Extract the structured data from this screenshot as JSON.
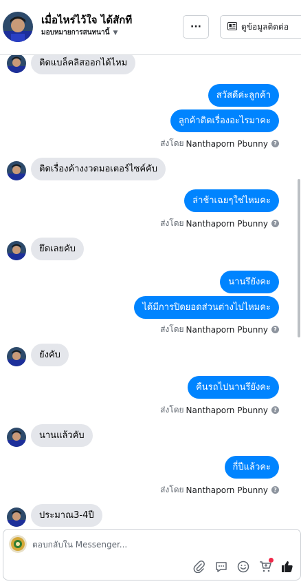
{
  "header": {
    "contact_name": "เมื่อไหร่ไว้ใจ ได้สักที",
    "assign_label": "มอบหมายการสนทนานี้",
    "more_label": "···",
    "contact_info_label": "ดูข้อมูลติดต่อ"
  },
  "messages": [
    {
      "side": "in",
      "text": "ติดแบล็คลิสออกได้ไหม"
    },
    {
      "side": "out",
      "text": "สวัสดีค่ะลูกค้า"
    },
    {
      "side": "out",
      "text": "ลูกค้าติดเรื่องอะไรมาคะ"
    },
    {
      "side": "sent_by",
      "prefix": "ส่งโดย",
      "name": "Nanthaporn Pbunny"
    },
    {
      "side": "in",
      "text": "ติดเรื่องค้างงวดมอเตอร์ไซค์คับ"
    },
    {
      "side": "out",
      "text": "ล่าช้าเฉยๆใช่ไหมคะ"
    },
    {
      "side": "sent_by",
      "prefix": "ส่งโดย",
      "name": "Nanthaporn Pbunny"
    },
    {
      "side": "in",
      "text": "ยึดเลยคับ"
    },
    {
      "side": "out",
      "text": "นานรึยังคะ"
    },
    {
      "side": "out",
      "text": "ได้มีการปิดยอดส่วนต่างไปไหมคะ"
    },
    {
      "side": "sent_by",
      "prefix": "ส่งโดย",
      "name": "Nanthaporn Pbunny"
    },
    {
      "side": "in",
      "text": "ยังคับ"
    },
    {
      "side": "out",
      "text": "คืนรถไปนานรึยังคะ"
    },
    {
      "side": "sent_by",
      "prefix": "ส่งโดย",
      "name": "Nanthaporn Pbunny"
    },
    {
      "side": "in",
      "text": "นานแล้วคับ"
    },
    {
      "side": "out",
      "text": "กี่ปีแล้วคะ"
    },
    {
      "side": "sent_by",
      "prefix": "ส่งโดย",
      "name": "Nanthaporn Pbunny"
    },
    {
      "side": "in",
      "text": "ประมาณ3-4ปี"
    }
  ],
  "composer": {
    "placeholder": "ตอบกลับใน Messenger...",
    "tools": [
      "paperclip-icon",
      "saved-reply-icon",
      "emoji-icon",
      "shop-cart-icon",
      "thumbs-up-icon"
    ]
  },
  "colors": {
    "outgoing_bubble": "#0084ff",
    "incoming_bubble": "#e4e6eb",
    "notification_dot": "#f02849"
  }
}
